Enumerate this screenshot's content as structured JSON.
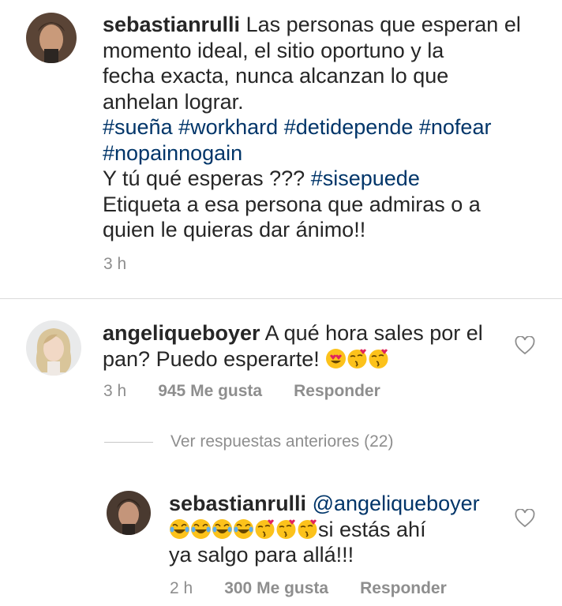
{
  "post": {
    "username": "sebastianrulli",
    "caption_lines": [
      "Las personas que esperan el",
      "momento ideal, el sitio oportuno y la",
      "fecha exacta, nunca alcanzan lo que",
      "anhelan lograr."
    ],
    "hashtags_line1": [
      "#sueña",
      "#workhard",
      "#detidepende",
      "#nofear"
    ],
    "hashtags_line2": [
      "#nopainnogain"
    ],
    "question_text": "Y tú qué esperas ???",
    "question_hashtag": "#sisepuede",
    "closing_lines": [
      "Etiqueta a esa persona que admiras o a",
      "quien le quieras dar ánimo!!"
    ],
    "time": "3 h"
  },
  "comment": {
    "username": "angeliqueboyer",
    "text_line1": "A qué hora sales por el",
    "text_line2": "pan? Puedo esperarte!",
    "emojis": [
      "heart-eyes",
      "kissing-heart",
      "kissing-heart"
    ],
    "time": "3 h",
    "likes": "945 Me gusta",
    "reply_label": "Responder"
  },
  "view_previous_replies": "Ver respuestas anteriores (22)",
  "reply": {
    "username": "sebastianrulli",
    "mention": "@angeliqueboyer",
    "emojis": [
      "joy",
      "joy",
      "joy",
      "joy",
      "kissing-heart",
      "kissing-heart",
      "kissing-heart"
    ],
    "text_after_emojis": "si estás ahí",
    "text_line3": "ya salgo para allá!!!",
    "time": "2 h",
    "likes": "300 Me gusta",
    "reply_label": "Responder"
  },
  "colors": {
    "text": "#262626",
    "hashtag": "#003569",
    "meta": "#8e8e8e",
    "divider": "#dbdbdb"
  }
}
